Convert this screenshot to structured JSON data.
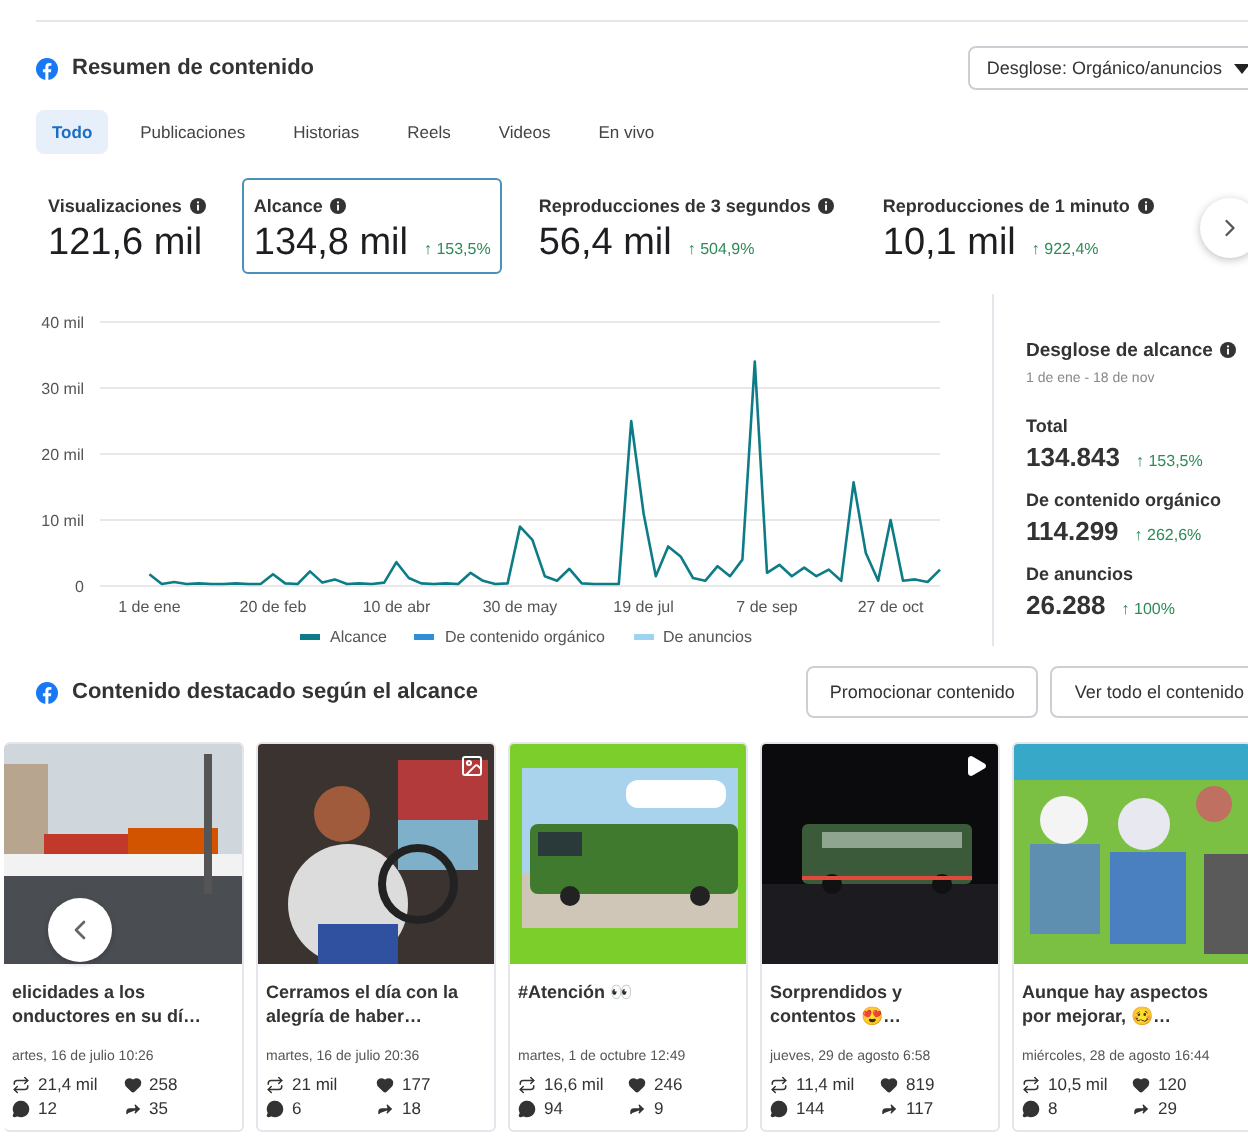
{
  "summary": {
    "title": "Resumen de contenido",
    "breakdown_dropdown": "Desglose: Orgánico/anuncios",
    "tabs": [
      {
        "label": "Todo",
        "selected": true
      },
      {
        "label": "Publicaciones",
        "selected": false
      },
      {
        "label": "Historias",
        "selected": false
      },
      {
        "label": "Reels",
        "selected": false
      },
      {
        "label": "Videos",
        "selected": false
      },
      {
        "label": "En vivo",
        "selected": false
      }
    ],
    "metrics": [
      {
        "label": "Visualizaciones",
        "value": "121,6 mil",
        "selected": false
      },
      {
        "label": "Alcance",
        "value": "134,8 mil",
        "change": "↑ 153,5%",
        "selected": true
      },
      {
        "label": "Reproducciones de 3 segundos",
        "value": "56,4 mil",
        "change": "↑ 504,9%",
        "selected": false
      },
      {
        "label": "Reproducciones de 1 minuto",
        "value": "10,1 mil",
        "change": "↑ 922,4%",
        "selected": false
      }
    ],
    "chart": {
      "chart_data": {
        "type": "line",
        "grid": true,
        "ylim": [
          0,
          40
        ],
        "yticks": [
          {
            "value": 0,
            "label": "0"
          },
          {
            "value": 10,
            "label": "10 mil"
          },
          {
            "value": 20,
            "label": "20 mil"
          },
          {
            "value": 30,
            "label": "30 mil"
          },
          {
            "value": 40,
            "label": "40 mil"
          }
        ],
        "categories": [
          "1 de ene",
          null,
          null,
          null,
          null,
          null,
          null,
          null,
          null,
          null,
          "20 de feb",
          null,
          null,
          null,
          null,
          null,
          null,
          null,
          null,
          null,
          "10 de abr",
          null,
          null,
          null,
          null,
          null,
          null,
          null,
          null,
          null,
          "30 de may",
          null,
          null,
          null,
          null,
          null,
          null,
          null,
          null,
          null,
          "19 de jul",
          null,
          null,
          null,
          null,
          null,
          null,
          null,
          null,
          null,
          "7 de sep",
          null,
          null,
          null,
          null,
          null,
          null,
          null,
          null,
          null,
          "27 de oct",
          null,
          null,
          null,
          null
        ],
        "series": [
          {
            "name": "Alcance",
            "color": "#0e7c86",
            "values": [
              1.8,
              0.3,
              0.6,
              0.3,
              0.4,
              0.3,
              0.3,
              0.4,
              0.3,
              0.3,
              1.8,
              0.4,
              0.3,
              2.2,
              0.5,
              1.0,
              0.3,
              0.4,
              0.3,
              0.5,
              3.6,
              1.2,
              0.4,
              0.3,
              0.4,
              0.3,
              2.0,
              0.8,
              0.3,
              0.4,
              9.0,
              7.0,
              1.5,
              0.8,
              2.6,
              0.4,
              0.3,
              0.3,
              0.3,
              25.0,
              11.0,
              1.5,
              6.0,
              4.5,
              1.2,
              0.8,
              3.0,
              1.5,
              4.0,
              34.0,
              2.0,
              3.2,
              1.5,
              2.8,
              1.5,
              2.5,
              0.8,
              15.7,
              5.0,
              0.8,
              10.0,
              0.8,
              1.0,
              0.6,
              2.5
            ]
          }
        ]
      },
      "legend": [
        {
          "label": "De contenido orgánico",
          "color": "#2f8fd6"
        },
        {
          "label": "De anuncios",
          "color": "#9fd3f2"
        }
      ]
    },
    "reach_breakdown": {
      "title": "Desglose de alcance",
      "date_range": "1 de ene - 18 de nov",
      "items": [
        {
          "label": "Total",
          "value": "134.843",
          "change": "↑ 153,5%"
        },
        {
          "label": "De contenido orgánico",
          "value": "114.299",
          "change": "↑ 262,6%"
        },
        {
          "label": "De anuncios",
          "value": "26.288",
          "change": "↑ 100%"
        }
      ]
    }
  },
  "featured": {
    "title": "Contenido destacado según el alcance",
    "buttons": [
      "Promocionar contenido",
      "Ver todo el contenido"
    ],
    "posts": [
      {
        "kind": "post",
        "caption": "elicidades a los\nonductores en su dí…",
        "date": "artes, 16 de julio 10:26",
        "reach": "21,4 mil",
        "likes": "258",
        "comments": "12",
        "shares": "35"
      },
      {
        "caption": "Cerramos el día con la\nalegría de haber…",
        "date": "martes, 16 de julio 20:36",
        "reach": "21 mil",
        "likes": "177",
        "comments": "6",
        "shares": "18"
      },
      {
        "kind": "post",
        "caption": "#Atención 👀",
        "date": "martes, 1 de octubre 12:49",
        "reach": "16,6 mil",
        "likes": "246",
        "comments": "94",
        "shares": "9"
      },
      {
        "kind": "video",
        "caption": "Sorprendidos y\ncontentos 😍…",
        "date": "jueves, 29 de agosto 6:58",
        "reach": "11,4 mil",
        "likes": "819",
        "comments": "144",
        "shares": "117"
      },
      {
        "kind": "post",
        "caption": "Aunque hay aspectos\npor mejorar, 🥴…",
        "date": "miércoles, 28 de agosto 16:44",
        "reach": "10,5 mil",
        "likes": "120",
        "comments": "8",
        "shares": "29"
      }
    ]
  }
}
